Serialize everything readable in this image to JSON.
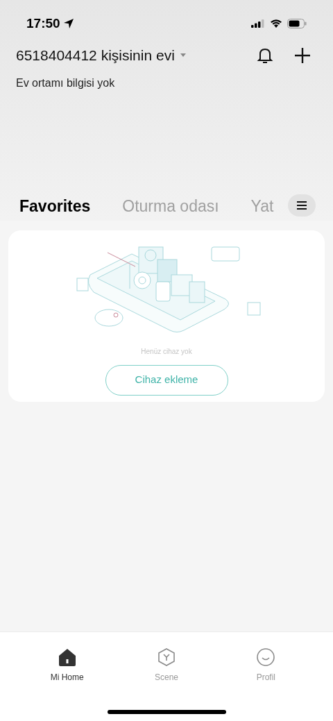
{
  "status_bar": {
    "time": "17:50"
  },
  "header": {
    "home_name": "6518404412 kişisinin evi",
    "subtitle": "Ev ortamı bilgisi yok"
  },
  "tabs": [
    {
      "label": "Favorites",
      "selected": true
    },
    {
      "label": "Oturma odası",
      "selected": false
    },
    {
      "label": "Yat",
      "selected": false
    }
  ],
  "empty_card": {
    "message": "Henüz cihaz yok",
    "button": "Cihaz ekleme"
  },
  "bottom_nav": [
    {
      "label": "Mi Home",
      "kind": "home",
      "selected": true
    },
    {
      "label": "Scene",
      "kind": "scene",
      "selected": false
    },
    {
      "label": "Profil",
      "kind": "profile",
      "selected": false
    }
  ]
}
